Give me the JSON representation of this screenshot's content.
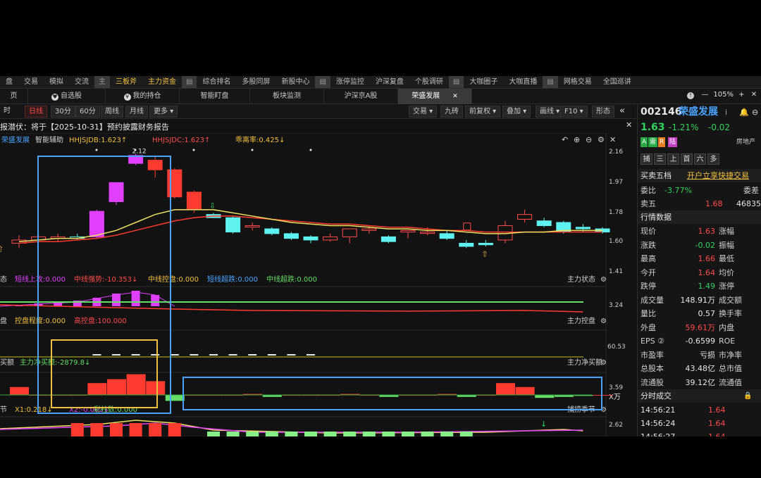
{
  "menu": [
    "盘",
    "交易",
    "模拟",
    "交流",
    "主",
    "三板斧",
    "主力资金",
    "|",
    "综合排名",
    "多股同屏",
    "新股中心",
    "|",
    "涨停监控",
    "沪深复盘",
    "个股调研",
    "|",
    "大咖圈子",
    "大咖直播",
    "|",
    "网格交易",
    "全国巡讲"
  ],
  "tabs": [
    {
      "label": "页"
    },
    {
      "label": "自选股",
      "icon": "♥"
    },
    {
      "label": "我的持仓",
      "icon": "¥"
    },
    {
      "label": "智能盯盘"
    },
    {
      "label": "板块监测"
    },
    {
      "label": "沪深京A股"
    },
    {
      "label": "荣盛发展",
      "active": true,
      "close": "✕"
    }
  ],
  "window": {
    "zoom": "105%",
    "info": "!",
    "minus": "—",
    "close": "✕"
  },
  "periods": [
    "时",
    "日线",
    "30分",
    "60分",
    "周线",
    "月线",
    "更多"
  ],
  "tools": [
    "交易",
    "九砖",
    "前复权",
    "叠加",
    "画线",
    "F10",
    "形态"
  ],
  "notice": {
    "text": "报潜伏：将于【2025-10-31】预约披露财务报告",
    "close": "✕"
  },
  "main_legend": [
    {
      "text": "荣盛发展",
      "color": "#4aa3ff"
    },
    {
      "text": "智能辅助",
      "color": "#d0d0d0"
    },
    {
      "text": "HHJSJDB:1.623↑",
      "color": "#f0c040"
    },
    {
      "text": "HHJSJDC:1.623↑",
      "color": "#ff5050"
    },
    {
      "text": "乖离率:0.425↓",
      "color": "#f0c040"
    }
  ],
  "panel_legends": {
    "p1": [
      {
        "text": "态",
        "color": "#cfcfcf"
      },
      {
        "text": "短线上攻:0.000",
        "color": "#e040fb"
      },
      {
        "text": "中线强势:-10.353↓",
        "color": "#ff4b4b"
      },
      {
        "text": "中线控盘:0.000",
        "color": "#f0c040"
      },
      {
        "text": "短线超跌:0.000",
        "color": "#4aa3ff"
      },
      {
        "text": "中线超跌:0.000",
        "color": "#66dd66"
      }
    ],
    "p1_name": "主力状态",
    "p2": [
      {
        "text": "盘",
        "color": "#cfcfcf"
      },
      {
        "text": "控盘程度:0.000",
        "color": "#f0c040"
      },
      {
        "text": "高控盘:100.000",
        "color": "#ff4b4b"
      }
    ],
    "p2_name": "主力控盘",
    "p3": [
      {
        "text": "买额",
        "color": "#cfcfcf"
      },
      {
        "text": "主力净买额:-2879.8↓",
        "color": "#66dd66"
      }
    ],
    "p3_name": "主力净买额",
    "p3_lower": [
      {
        "text": "彩柱数:0.000",
        "color": "#66dd66"
      }
    ],
    "p3_lower_name": "捕捞季节",
    "p4": [
      {
        "text": "节",
        "color": "#cfcfcf"
      },
      {
        "text": "X1:0.218↓",
        "color": "#f0c040"
      },
      {
        "text": "X2:-0.003↓",
        "color": "#e040fb"
      }
    ]
  },
  "axis": {
    "main": [
      "2.16",
      "1.97",
      "1.78",
      "1.60",
      "1.41"
    ],
    "p1": "3.24",
    "p2": "60.53",
    "p3": "3.59",
    "p3_unit": "X万",
    "p4": "2.62"
  },
  "chart_data": {
    "type": "candlestick",
    "high_label": "2.12",
    "x_axis_label": "",
    "candles": [
      {
        "o": 1.58,
        "h": 1.63,
        "l": 1.55,
        "c": 1.6
      },
      {
        "o": 1.6,
        "h": 1.64,
        "l": 1.58,
        "c": 1.62
      },
      {
        "o": 1.61,
        "h": 1.64,
        "l": 1.59,
        "c": 1.62
      },
      {
        "o": 1.62,
        "h": 1.64,
        "l": 1.6,
        "c": 1.61
      },
      {
        "o": 1.62,
        "h": 1.79,
        "l": 1.61,
        "c": 1.78
      },
      {
        "o": 1.84,
        "h": 1.96,
        "l": 1.82,
        "c": 1.96
      },
      {
        "o": 2.13,
        "h": 2.14,
        "l": 2.07,
        "c": 2.08
      },
      {
        "o": 2.1,
        "h": 2.12,
        "l": 1.99,
        "c": 2.04
      },
      {
        "o": 2.04,
        "h": 2.05,
        "l": 1.86,
        "c": 1.87
      },
      {
        "o": 1.9,
        "h": 1.91,
        "l": 1.77,
        "c": 1.79
      },
      {
        "o": 1.76,
        "h": 1.77,
        "l": 1.74,
        "c": 1.74
      },
      {
        "o": 1.74,
        "h": 1.75,
        "l": 1.64,
        "c": 1.65
      },
      {
        "o": 1.69,
        "h": 1.71,
        "l": 1.66,
        "c": 1.69
      },
      {
        "o": 1.67,
        "h": 1.68,
        "l": 1.63,
        "c": 1.64
      },
      {
        "o": 1.64,
        "h": 1.65,
        "l": 1.6,
        "c": 1.61
      },
      {
        "o": 1.62,
        "h": 1.63,
        "l": 1.58,
        "c": 1.6
      },
      {
        "o": 1.6,
        "h": 1.64,
        "l": 1.59,
        "c": 1.62
      },
      {
        "o": 1.62,
        "h": 1.67,
        "l": 1.58,
        "c": 1.67
      },
      {
        "o": 1.66,
        "h": 1.69,
        "l": 1.64,
        "c": 1.67
      },
      {
        "o": 1.62,
        "h": 1.63,
        "l": 1.58,
        "c": 1.59
      },
      {
        "o": 1.65,
        "h": 1.66,
        "l": 1.61,
        "c": 1.66
      },
      {
        "o": 1.65,
        "h": 1.68,
        "l": 1.63,
        "c": 1.65
      },
      {
        "o": 1.64,
        "h": 1.66,
        "l": 1.6,
        "c": 1.61
      },
      {
        "o": 1.58,
        "h": 1.6,
        "l": 1.55,
        "c": 1.56
      },
      {
        "o": 1.58,
        "h": 1.6,
        "l": 1.56,
        "c": 1.57
      },
      {
        "o": 1.6,
        "h": 1.72,
        "l": 1.58,
        "c": 1.69
      },
      {
        "o": 1.73,
        "h": 1.79,
        "l": 1.71,
        "c": 1.76
      },
      {
        "o": 1.72,
        "h": 1.74,
        "l": 1.68,
        "c": 1.69
      },
      {
        "o": 1.71,
        "h": 1.72,
        "l": 1.64,
        "c": 1.65
      },
      {
        "o": 1.68,
        "h": 1.7,
        "l": 1.65,
        "c": 1.67
      },
      {
        "o": 1.67,
        "h": 1.68,
        "l": 1.64,
        "c": 1.65
      }
    ],
    "ma_fast": [
      1.59,
      1.6,
      1.61,
      1.61,
      1.63,
      1.66,
      1.71,
      1.76,
      1.79,
      1.79,
      1.79,
      1.77,
      1.75,
      1.73,
      1.71,
      1.7,
      1.69,
      1.69,
      1.68,
      1.67,
      1.67,
      1.66,
      1.66,
      1.65,
      1.64,
      1.64,
      1.65,
      1.65,
      1.66,
      1.66,
      1.66
    ],
    "ma_slow": [
      1.58,
      1.59,
      1.59,
      1.6,
      1.61,
      1.63,
      1.66,
      1.69,
      1.72,
      1.74,
      1.75,
      1.75,
      1.74,
      1.73,
      1.72,
      1.71,
      1.7,
      1.7,
      1.69,
      1.68,
      1.68,
      1.67,
      1.66,
      1.66,
      1.65,
      1.65,
      1.65,
      1.65,
      1.65,
      1.65,
      1.65
    ],
    "ylim": [
      1.41,
      2.16
    ],
    "net_buy": [
      0.8,
      0,
      0,
      0,
      1.2,
      1.6,
      2.1,
      1.4,
      -0.6,
      0,
      0,
      0,
      0.1,
      -0.2,
      0,
      0,
      0,
      0.1,
      0,
      -0.2,
      0,
      0,
      0.1,
      -0.2,
      0,
      1.2,
      0.8,
      -0.3,
      -0.2,
      -0.1,
      0
    ]
  },
  "quote": {
    "code": "002146",
    "name": "荣盛发展",
    "info": "i",
    "price": "1.63",
    "pct": "-1.21%",
    "chg": "-0.02",
    "tags": [
      {
        "text": "A",
        "color": "#28a745"
      },
      {
        "text": "雷",
        "color": "#28a745"
      },
      {
        "text": "R",
        "color": "#e67e22"
      },
      {
        "text": "陆",
        "color": "#c040c0"
      }
    ],
    "industry": "房地产",
    "quick": [
      "捕",
      "三",
      "上",
      "首",
      "六",
      "多"
    ],
    "five_title": "买卖五档",
    "five_link": "开户立享快捷交易",
    "webi_label": "委比",
    "webi": "-3.77%",
    "wecha": "委差",
    "sell5_label": "卖五",
    "sell5_price": "1.68",
    "sell5_vol": "46835",
    "market_title": "行情数据",
    "rows": [
      [
        {
          "l": "现价"
        },
        {
          "v": "1.63",
          "c": "r"
        },
        {
          "l": "涨幅"
        }
      ],
      [
        {
          "l": "涨跌"
        },
        {
          "v": "-0.02",
          "c": "g"
        },
        {
          "l": "振幅"
        }
      ],
      [
        {
          "l": "最高"
        },
        {
          "v": "1.66",
          "c": "r"
        },
        {
          "l": "最低"
        }
      ],
      [
        {
          "l": "今开"
        },
        {
          "v": "1.64",
          "c": "r"
        },
        {
          "l": "均价"
        }
      ],
      [
        {
          "l": "跌停"
        },
        {
          "v": "1.49",
          "c": "g"
        },
        {
          "l": "涨停"
        }
      ],
      [
        {
          "l": "成交量"
        },
        {
          "v": "148.91万",
          "c": "w"
        },
        {
          "l": "成交额"
        }
      ],
      [
        {
          "l": "量比"
        },
        {
          "v": "0.57",
          "c": "w"
        },
        {
          "l": "换手率"
        }
      ],
      [
        {
          "l": "外盘"
        },
        {
          "v": "59.61万",
          "c": "r"
        },
        {
          "l": "内盘"
        }
      ],
      [
        {
          "l": "EPS ②"
        },
        {
          "v": "-0.6599",
          "c": "w"
        },
        {
          "l": "ROE"
        }
      ],
      [
        {
          "l": "市盈率"
        },
        {
          "v": "亏损",
          "c": "w"
        },
        {
          "l": "市净率"
        }
      ],
      [
        {
          "l": "总股本"
        },
        {
          "v": "43.48亿",
          "c": "w"
        },
        {
          "l": "总市值"
        }
      ],
      [
        {
          "l": "流通股"
        },
        {
          "v": "39.12亿",
          "c": "w"
        },
        {
          "l": "流通值"
        }
      ]
    ],
    "trades_title": "分时成交",
    "trades": [
      {
        "t": "14:56:21",
        "p": "1.64"
      },
      {
        "t": "14:56:24",
        "p": "1.64"
      },
      {
        "t": "14:56:27",
        "p": "1.64"
      }
    ]
  }
}
